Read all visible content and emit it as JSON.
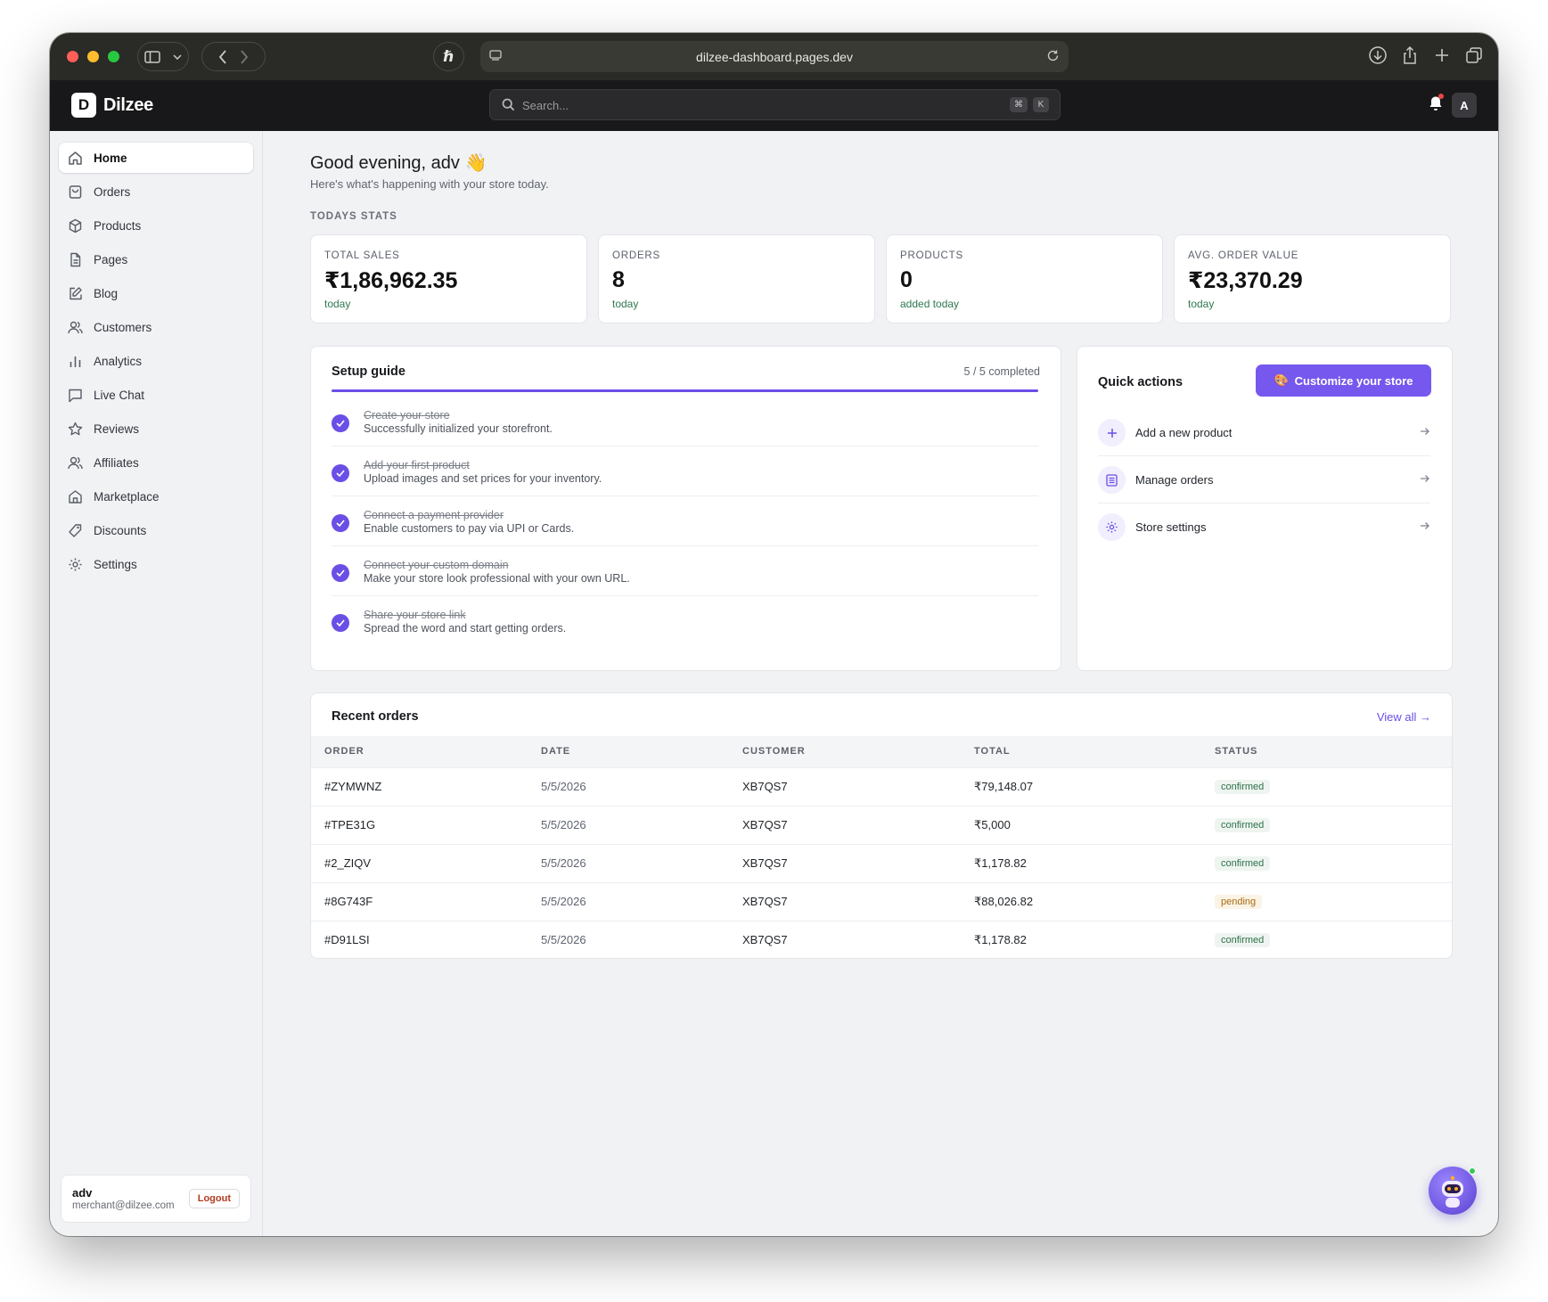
{
  "browser": {
    "url": "dilzee-dashboard.pages.dev"
  },
  "app": {
    "logo_letter": "D",
    "logo_text": "Dilzee",
    "search_placeholder": "Search...",
    "shortcut_keys": [
      "⌘",
      "K"
    ],
    "avatar_initial": "A"
  },
  "sidebar": {
    "items": [
      {
        "label": "Home",
        "icon": "home-icon",
        "active": true
      },
      {
        "label": "Orders",
        "icon": "orders-icon"
      },
      {
        "label": "Products",
        "icon": "package-icon"
      },
      {
        "label": "Pages",
        "icon": "file-icon"
      },
      {
        "label": "Blog",
        "icon": "edit-icon"
      },
      {
        "label": "Customers",
        "icon": "users-icon"
      },
      {
        "label": "Analytics",
        "icon": "bar-chart-icon"
      },
      {
        "label": "Live Chat",
        "icon": "chat-icon"
      },
      {
        "label": "Reviews",
        "icon": "star-icon"
      },
      {
        "label": "Affiliates",
        "icon": "users-icon"
      },
      {
        "label": "Marketplace",
        "icon": "store-icon"
      },
      {
        "label": "Discounts",
        "icon": "tag-icon"
      },
      {
        "label": "Settings",
        "icon": "gear-icon"
      }
    ],
    "user": {
      "name": "adv",
      "email": "merchant@dilzee.com",
      "logout_label": "Logout"
    }
  },
  "main": {
    "greeting": "Good evening, adv 👋",
    "subtitle": "Here's what's happening with your store today.",
    "stats_label": "TODAYS STATS",
    "stats": [
      {
        "label": "TOTAL SALES",
        "value": "₹1,86,962.35",
        "sub": "today"
      },
      {
        "label": "ORDERS",
        "value": "8",
        "sub": "today"
      },
      {
        "label": "PRODUCTS",
        "value": "0",
        "sub": "added today"
      },
      {
        "label": "AVG. ORDER VALUE",
        "value": "₹23,370.29",
        "sub": "today"
      }
    ],
    "setup": {
      "title": "Setup guide",
      "completed_text": "5 / 5 completed",
      "progress": 1.0,
      "steps": [
        {
          "title": "Create your store",
          "desc": "Successfully initialized your storefront."
        },
        {
          "title": "Add your first product",
          "desc": "Upload images and set prices for your inventory."
        },
        {
          "title": "Connect a payment provider",
          "desc": "Enable customers to pay via UPI or Cards."
        },
        {
          "title": "Connect your custom domain",
          "desc": "Make your store look professional with your own URL."
        },
        {
          "title": "Share your store link",
          "desc": "Spread the word and start getting orders."
        }
      ]
    },
    "quick_actions": {
      "title": "Quick actions",
      "cta_label": "Customize your store",
      "cta_icon": "palette-icon",
      "items": [
        {
          "label": "Add a new product",
          "icon": "plus-icon"
        },
        {
          "label": "Manage orders",
          "icon": "list-icon"
        },
        {
          "label": "Store settings",
          "icon": "gear-icon"
        }
      ]
    },
    "recent_orders": {
      "title": "Recent orders",
      "view_all": "View all →",
      "columns": [
        "ORDER",
        "DATE",
        "CUSTOMER",
        "TOTAL",
        "STATUS"
      ],
      "rows": [
        {
          "order": "#ZYMWNZ",
          "date": "5/5/2026",
          "customer": "XB7QS7",
          "total": "₹79,148.07",
          "status": "confirmed"
        },
        {
          "order": "#TPE31G",
          "date": "5/5/2026",
          "customer": "XB7QS7",
          "total": "₹5,000",
          "status": "confirmed"
        },
        {
          "order": "#2_ZIQV",
          "date": "5/5/2026",
          "customer": "XB7QS7",
          "total": "₹1,178.82",
          "status": "confirmed"
        },
        {
          "order": "#8G743F",
          "date": "5/5/2026",
          "customer": "XB7QS7",
          "total": "₹88,026.82",
          "status": "pending"
        },
        {
          "order": "#D91LSI",
          "date": "5/5/2026",
          "customer": "XB7QS7",
          "total": "₹1,178.82",
          "status": "confirmed"
        }
      ]
    }
  },
  "colors": {
    "accent": "#6b4ee6",
    "cta": "#7658ee",
    "topbar": "#18181a",
    "confirmed": "#2e7048",
    "pending": "#a86a10"
  }
}
